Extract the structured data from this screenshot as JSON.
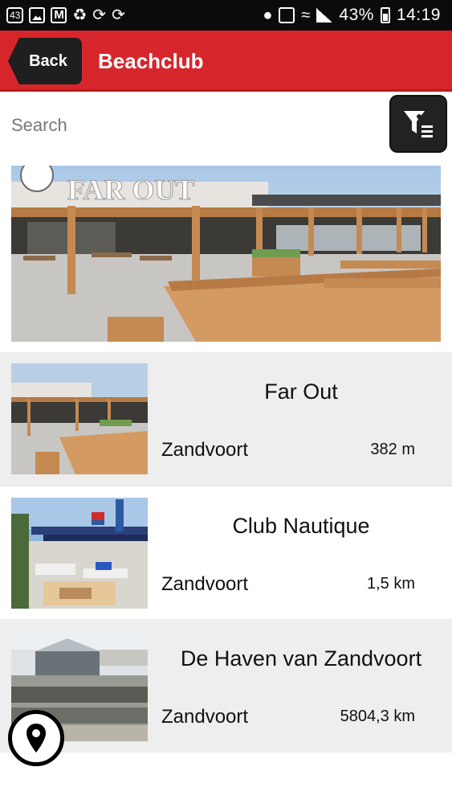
{
  "status_bar": {
    "notification_badge": "43",
    "battery_percent": "43%",
    "time": "14:19",
    "icons": [
      "notification-count-icon",
      "image-icon",
      "gmail-icon",
      "tasks-icon",
      "sync-icon",
      "sync-icon",
      "location-icon",
      "nfc-icon",
      "wifi-icon",
      "signal-icon",
      "battery-icon"
    ]
  },
  "header": {
    "back_label": "Back",
    "title": "Beachclub",
    "color": "#d7262b"
  },
  "search": {
    "placeholder": "Search",
    "value": ""
  },
  "filter_button": {
    "icon": "filter-icon"
  },
  "hero": {
    "sign_text": "FAR OUT"
  },
  "list": [
    {
      "name": "Far Out",
      "city": "Zandvoort",
      "distance": "382 m"
    },
    {
      "name": "Club Nautique",
      "city": "Zandvoort",
      "distance": "1,5 km"
    },
    {
      "name": "De Haven van Zandvoort",
      "city": "Zandvoort",
      "distance": "5804,3 km"
    }
  ],
  "map_button": {
    "icon": "map-pin-icon"
  }
}
